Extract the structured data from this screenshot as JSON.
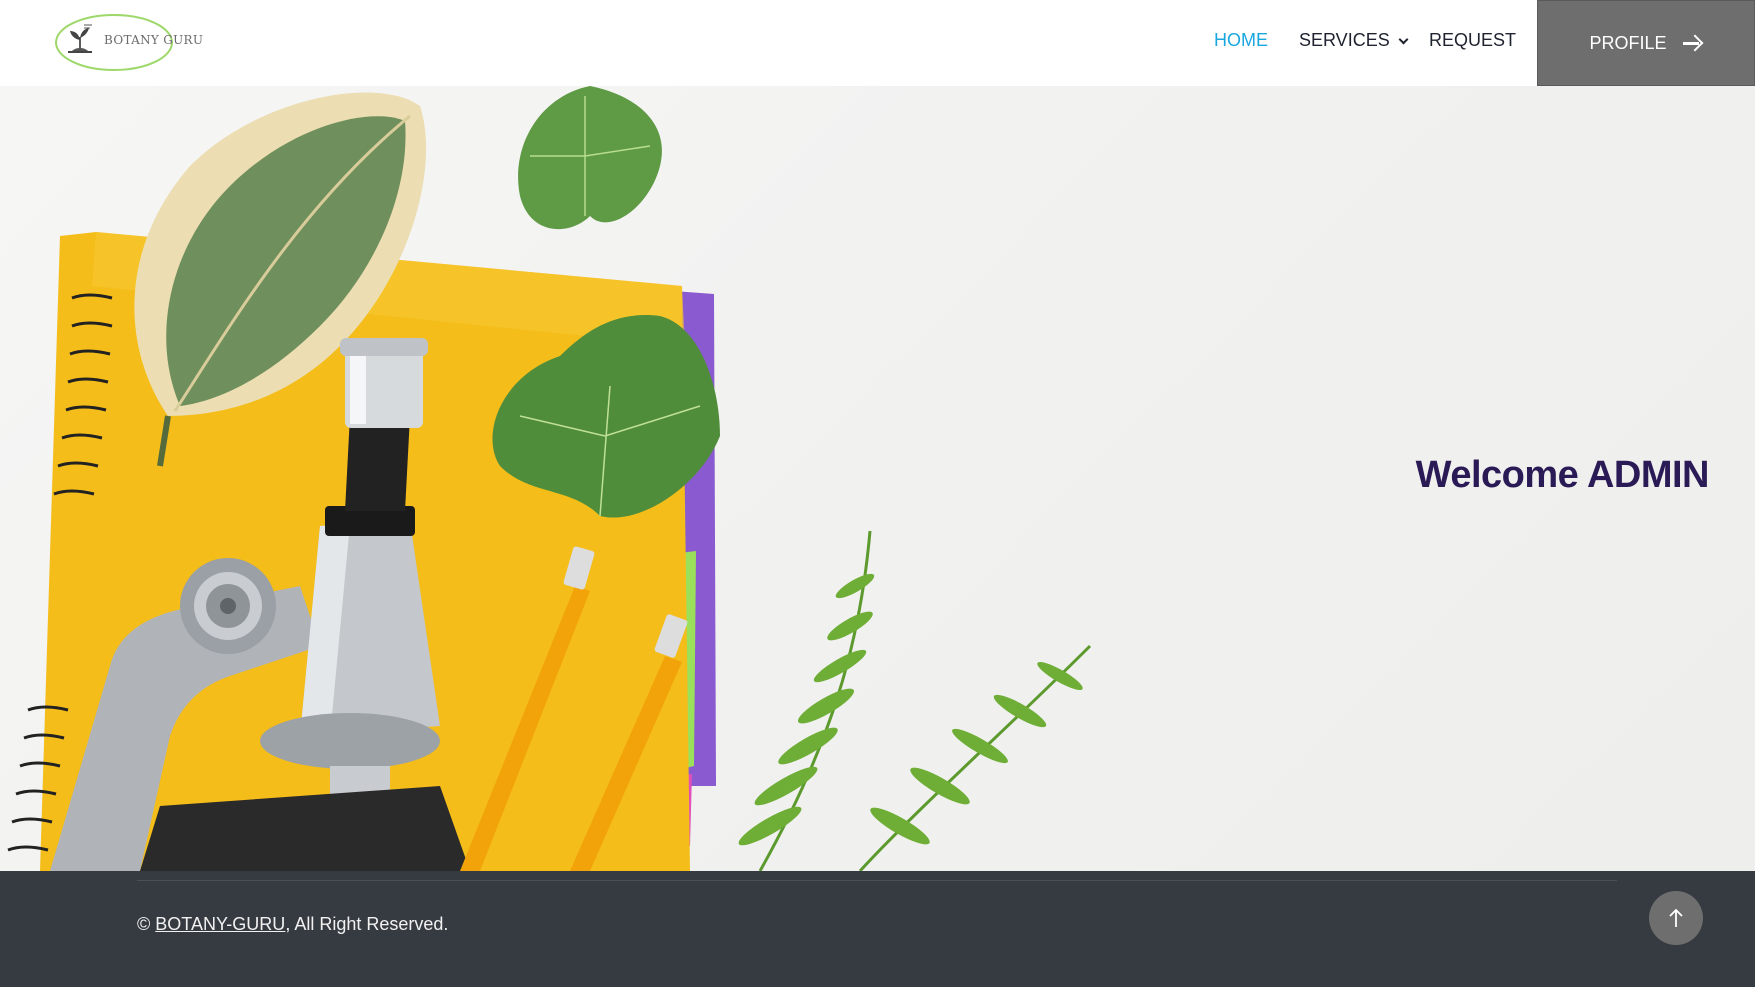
{
  "header": {
    "logo_text": "BOTANY GURU",
    "nav": [
      {
        "label": "HOME",
        "active": true
      },
      {
        "label": "SERVICES",
        "has_dropdown": true
      },
      {
        "label": "REQUEST"
      }
    ],
    "profile_label": "PROFILE"
  },
  "hero": {
    "welcome_text": "Welcome ADMIN"
  },
  "footer": {
    "copyright_symbol": "©",
    "brand_link": "BOTANY-GURU",
    "rights_text": ", All Right Reserved."
  },
  "colors": {
    "active_nav": "#1aa7e0",
    "profile_button": "#6e6e6e",
    "welcome_text": "#2a1a55",
    "footer_bg": "#363a41"
  },
  "icons": {
    "profile_arrow": "arrow-right-icon",
    "services_chevron": "chevron-down-icon",
    "back_to_top": "arrow-up-icon"
  }
}
